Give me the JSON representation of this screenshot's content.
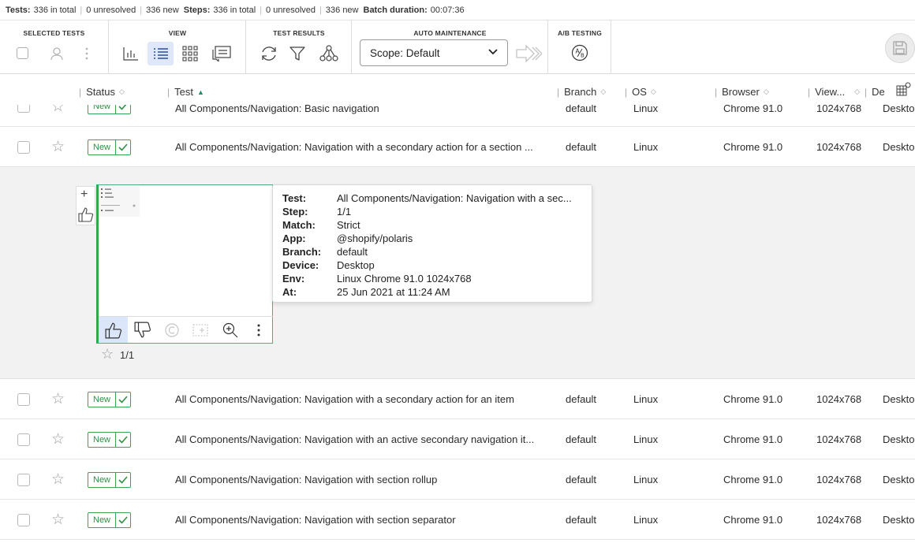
{
  "summary": {
    "tests_label": "Tests:",
    "tests_total": "336 in total",
    "tests_unresolved": "0 unresolved",
    "tests_new": "336 new",
    "steps_label": "Steps:",
    "steps_total": "336 in total",
    "steps_unresolved": "0 unresolved",
    "steps_new": "336 new",
    "batch_label": "Batch duration:",
    "batch_duration": "00:07:36"
  },
  "toolbar": {
    "selected_tests_title": "SELECTED TESTS",
    "view_title": "VIEW",
    "test_results_title": "TEST RESULTS",
    "auto_maintenance_title": "AUTO MAINTENANCE",
    "ab_testing_title": "A/B TESTING",
    "scope_value": "Scope: Default"
  },
  "columns": {
    "status": "Status",
    "test": "Test",
    "branch": "Branch",
    "os": "OS",
    "browser": "Browser",
    "viewport": "View...",
    "device": "De"
  },
  "rows": [
    {
      "status": "New",
      "test": "All Components/Navigation: Basic navigation",
      "branch": "default",
      "os": "Linux",
      "browser": "Chrome 91.0",
      "viewport": "1024x768",
      "device": "Desktop"
    },
    {
      "status": "New",
      "test": "All Components/Navigation: Navigation with a secondary action for a section ...",
      "branch": "default",
      "os": "Linux",
      "browser": "Chrome 91.0",
      "viewport": "1024x768",
      "device": "Desktop"
    },
    {
      "status": "New",
      "test": "All Components/Navigation: Navigation with a secondary action for an item",
      "branch": "default",
      "os": "Linux",
      "browser": "Chrome 91.0",
      "viewport": "1024x768",
      "device": "Desktop"
    },
    {
      "status": "New",
      "test": "All Components/Navigation: Navigation with an active secondary navigation it...",
      "branch": "default",
      "os": "Linux",
      "browser": "Chrome 91.0",
      "viewport": "1024x768",
      "device": "Desktop"
    },
    {
      "status": "New",
      "test": "All Components/Navigation: Navigation with section rollup",
      "branch": "default",
      "os": "Linux",
      "browser": "Chrome 91.0",
      "viewport": "1024x768",
      "device": "Desktop"
    },
    {
      "status": "New",
      "test": "All Components/Navigation: Navigation with section separator",
      "branch": "default",
      "os": "Linux",
      "browser": "Chrome 91.0",
      "viewport": "1024x768",
      "device": "Desktop"
    }
  ],
  "expanded": {
    "step_count": "1/1",
    "tooltip": {
      "test_k": "Test:",
      "test_v": "All Components/Navigation: Navigation with a sec...",
      "step_k": "Step:",
      "step_v": "1/1",
      "match_k": "Match:",
      "match_v": "Strict",
      "app_k": "App:",
      "app_v": "@shopify/polaris",
      "branch_k": "Branch:",
      "branch_v": "default",
      "device_k": "Device:",
      "device_v": "Desktop",
      "env_k": "Env:",
      "env_v": "Linux Chrome 91.0 1024x768",
      "at_k": "At:",
      "at_v": "25 Jun 2021 at 11:24 AM"
    }
  },
  "colors": {
    "accent": "#2f8f44",
    "active_bg": "#dfe8fa",
    "sort_active": "#1a8f6b"
  }
}
